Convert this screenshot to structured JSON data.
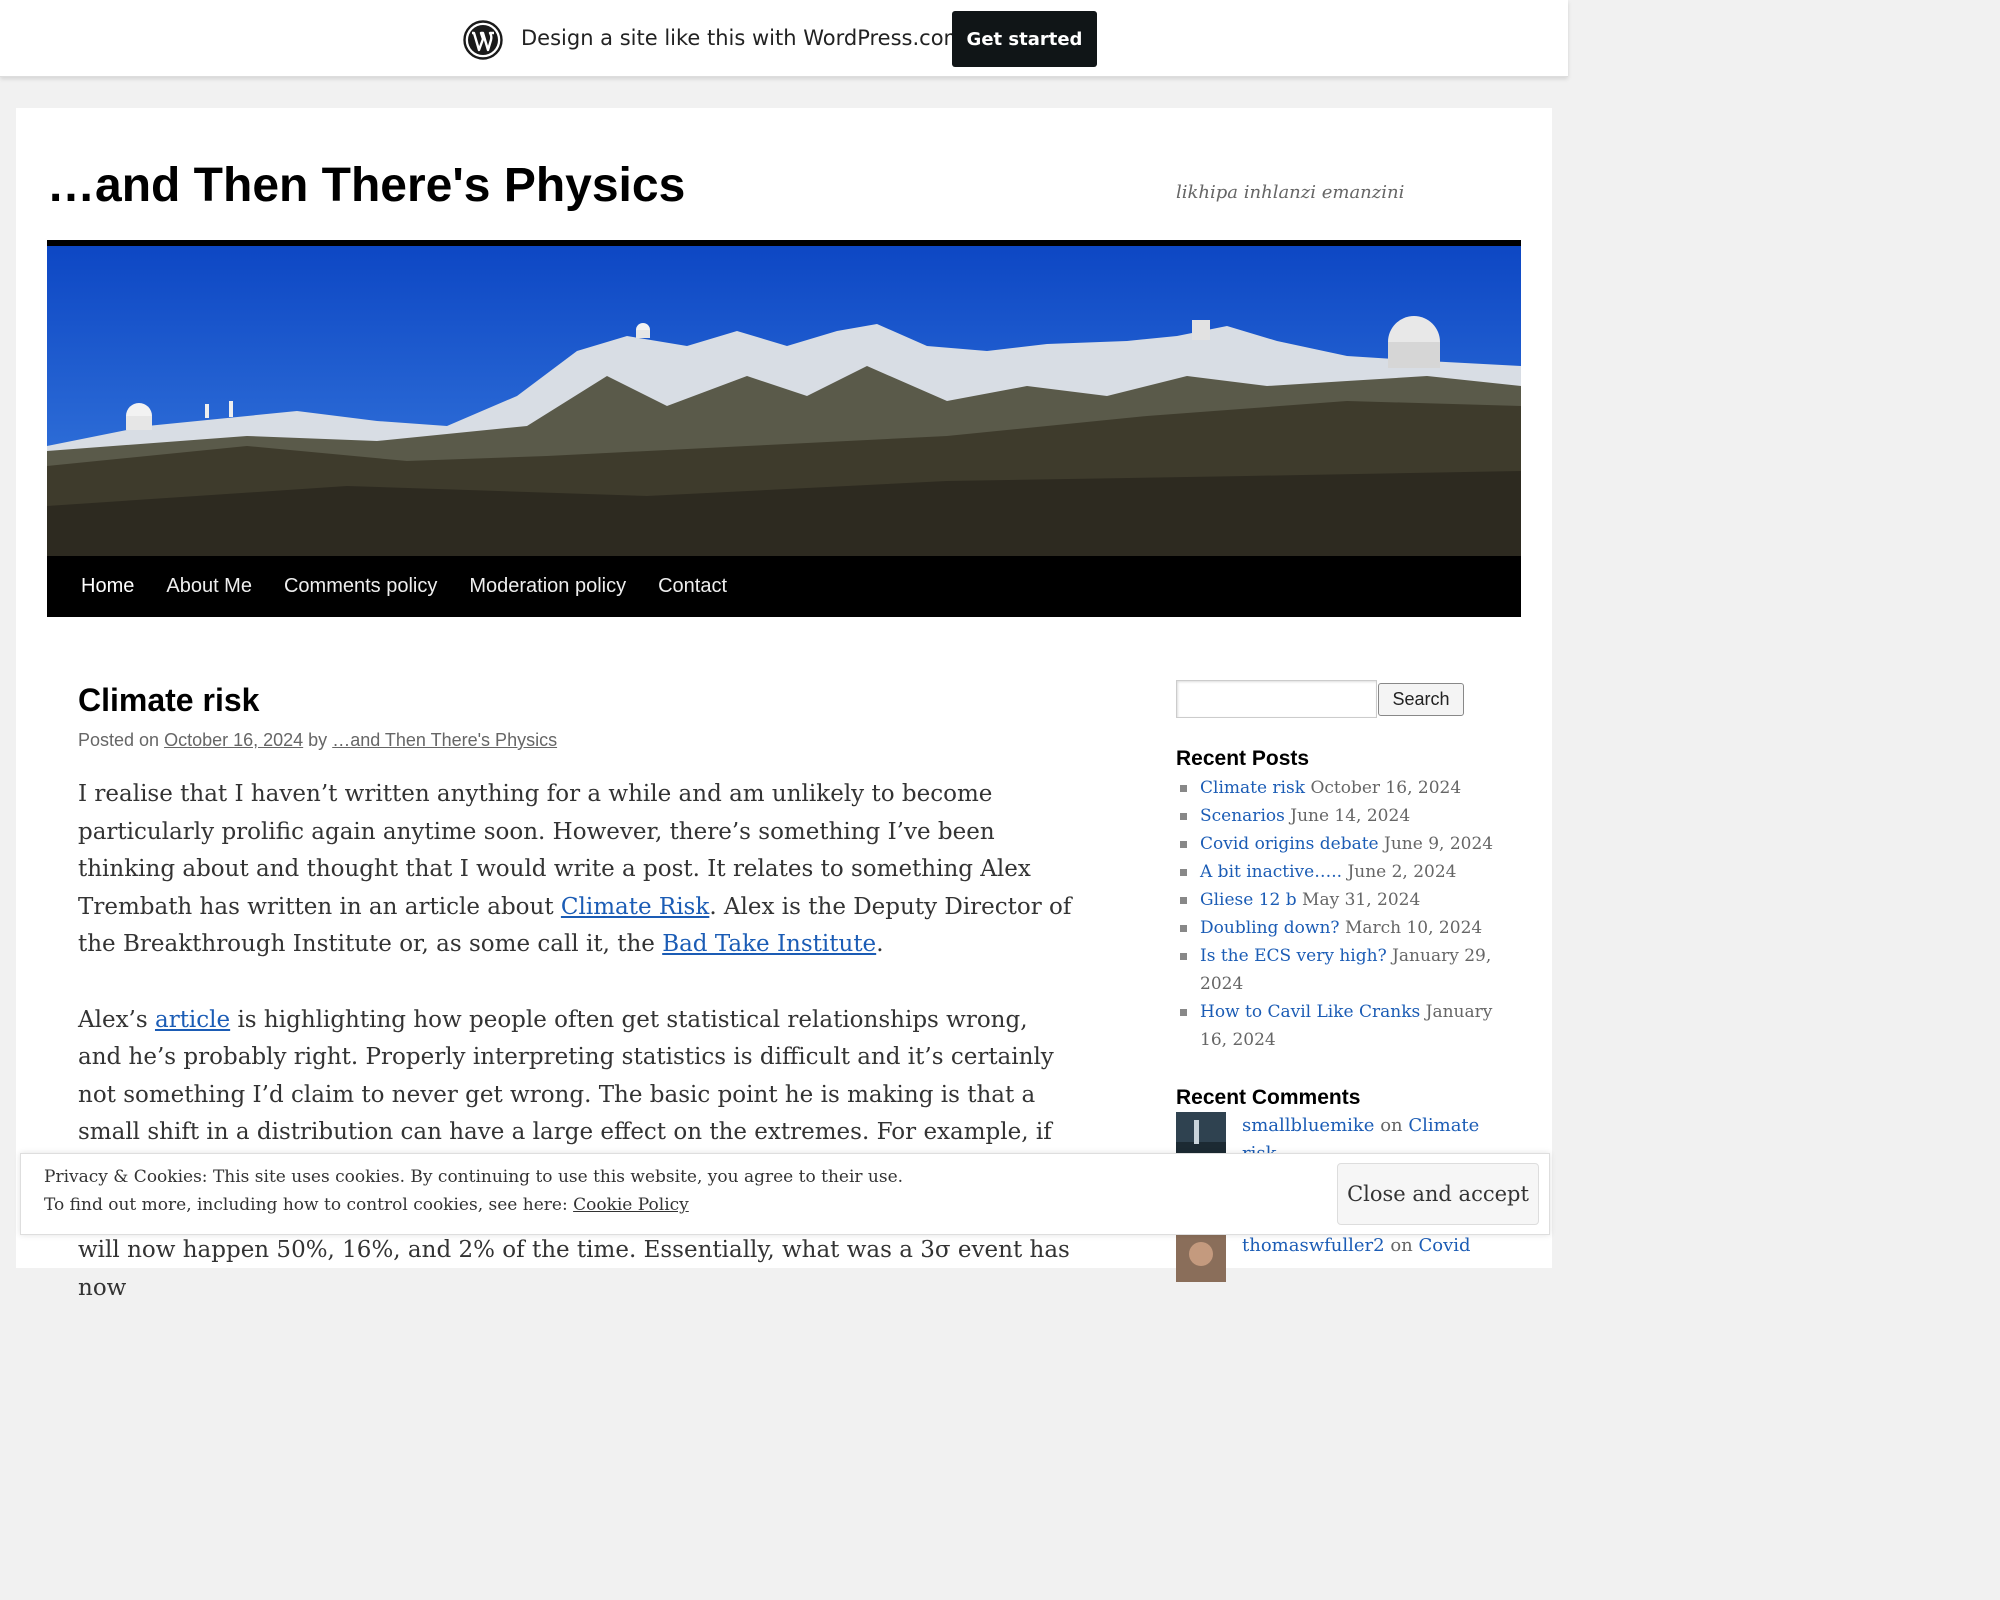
{
  "wpbar": {
    "text": "Design a site like this with WordPress.com",
    "button": "Get started",
    "logo_icon": "wordpress-logo-icon"
  },
  "site": {
    "title": "…and Then There's Physics",
    "description": "likhipa inhlanzi emanzini"
  },
  "nav": [
    "Home",
    "About Me",
    "Comments policy",
    "Moderation policy",
    "Contact"
  ],
  "post": {
    "title": "Climate risk",
    "meta_prefix": "Posted on ",
    "date": "October 16, 2024",
    "meta_by": " by ",
    "author": "…and Then There's Physics",
    "p1_a": "I realise that I haven’t written anything for a while and am unlikely to become particularly prolific again anytime soon. However, there’s something I’ve been thinking about and thought that I would write a post. It relates to something Alex Trembath has written in an article about ",
    "p1_link1": "Climate Risk",
    "p1_b": ". Alex is the Deputy Director of the Breakthrough Institute or, as some call it, the ",
    "p1_link2": "Bad Take Institute",
    "p1_c": ".",
    "p2_a": "Alex’s ",
    "p2_link": "article",
    "p2_b": " is highlighting how people often get statistical relationships wrong, and he’s probably right. Properly interpreting statistics is difficult and it’s certainly not something I’d claim to never get wrong. The basic point he is making is that a small shift in a distribution can have a large effect on the extremes. For example, if we consider one side",
    "p3": "will now happen 50%, 16%, and 2% of the time. Essentially, what was a 3σ event has now"
  },
  "sidebar": {
    "search_button": "Search",
    "search_value": "",
    "recent_posts_title": "Recent Posts",
    "recent_posts": [
      {
        "title": "Climate risk",
        "date": "October 16, 2024"
      },
      {
        "title": "Scenarios",
        "date": "June 14, 2024"
      },
      {
        "title": "Covid origins debate",
        "date": "June 9, 2024"
      },
      {
        "title": "A bit inactive…..",
        "date": "June 2, 2024"
      },
      {
        "title": "Gliese 12 b",
        "date": "May 31, 2024"
      },
      {
        "title": "Doubling down?",
        "date": "March 10, 2024"
      },
      {
        "title": "Is the ECS very high?",
        "date": "January 29, 2024"
      },
      {
        "title": "How to Cavil Like Cranks",
        "date": "January 16, 2024"
      }
    ],
    "recent_comments_title": "Recent Comments",
    "comments": [
      {
        "author": "smallbluemike",
        "on": " on ",
        "post": "Climate risk"
      },
      {
        "author": "thomaswfuller2",
        "on": " on ",
        "post": "Covid"
      }
    ]
  },
  "cookie": {
    "line1": "Privacy & Cookies: This site uses cookies. By continuing to use this website, you agree to their use.",
    "line2_prefix": "To find out more, including how to control cookies, see here: ",
    "policy_link": "Cookie Policy",
    "button": "Close and accept"
  },
  "colors": {
    "link": "#1b5cb5",
    "wp_button": "#101517",
    "nav_bg": "#000000"
  }
}
